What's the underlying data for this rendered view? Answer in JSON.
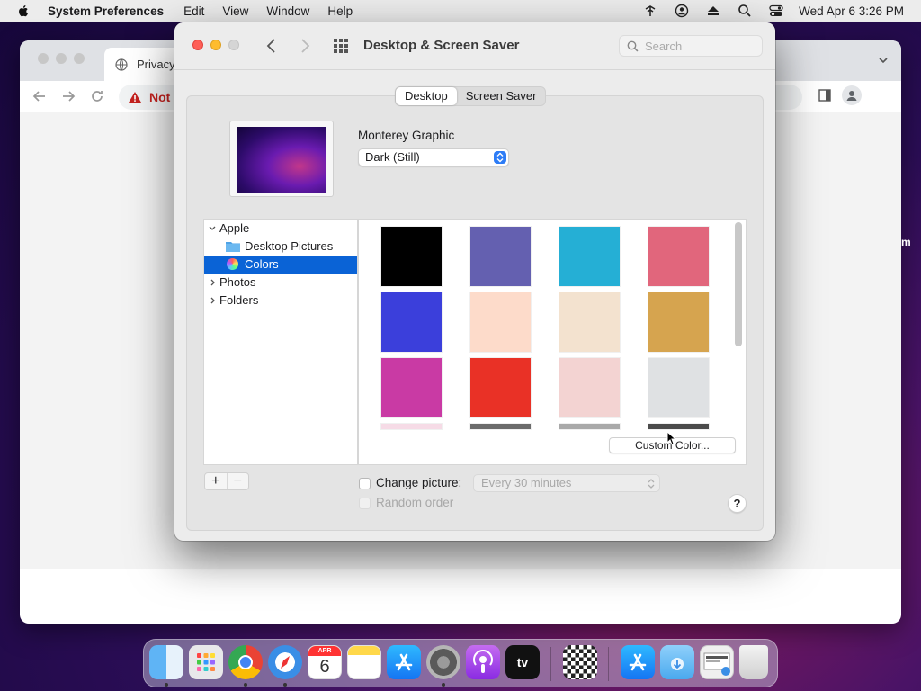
{
  "menubar": {
    "app_name": "System Preferences",
    "items": [
      "Edit",
      "View",
      "Window",
      "Help"
    ],
    "clock": "Wed Apr 6  3:26 PM"
  },
  "browser": {
    "tab_title": "Privacy",
    "address_warning": "Not s"
  },
  "prefs": {
    "title": "Desktop & Screen Saver",
    "search_placeholder": "Search",
    "tabs": [
      {
        "label": "Desktop",
        "selected": true
      },
      {
        "label": "Screen Saver",
        "selected": false
      }
    ],
    "wallpaper_name": "Monterey Graphic",
    "appearance_value": "Dark (Still)",
    "sources": [
      {
        "label": "Apple",
        "expanded": true
      },
      {
        "label": "Desktop Pictures"
      },
      {
        "label": "Colors",
        "selected": true
      },
      {
        "label": "Photos",
        "expanded": false
      },
      {
        "label": "Folders",
        "expanded": false
      }
    ],
    "colors": [
      "#000000",
      "#6460b0",
      "#25afd5",
      "#e1667c",
      "#3b3fdb",
      "#fddbca",
      "#f3e2cf",
      "#d6a44f",
      "#c93aa4",
      "#e93126",
      "#f3d3d2",
      "#dfe1e3"
    ],
    "colors_partial_row": [
      "#f6dbe6",
      "#6b6b6b",
      "#a9a9a9",
      "#4b4b4b"
    ],
    "custom_color_label": "Custom Color...",
    "add_label": "+",
    "remove_label": "−",
    "change_picture_label": "Change picture:",
    "change_picture_interval": "Every 30 minutes",
    "random_order_label": "Random order",
    "help_label": "?"
  },
  "dock": {
    "calendar_month": "APR",
    "calendar_day": "6",
    "tv_label": "tv"
  }
}
